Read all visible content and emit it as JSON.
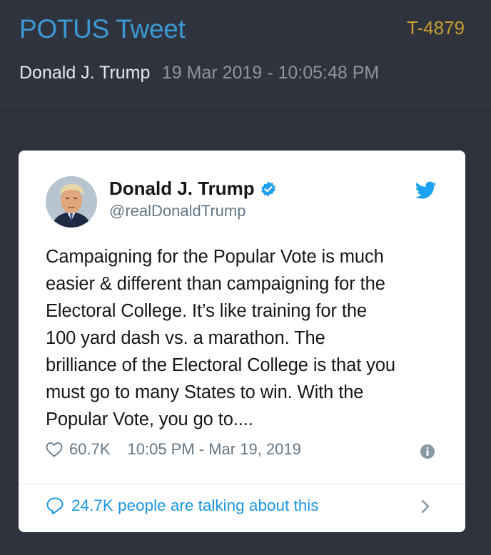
{
  "header": {
    "title": "POTUS Tweet",
    "tweet_id": "T-4879",
    "author": "Donald J. Trump",
    "datetime": "19 Mar 2019 - 10:05:48 PM"
  },
  "tweet": {
    "display_name": "Donald J. Trump",
    "handle": "@realDonaldTrump",
    "text": "Campaigning for the Popular Vote is much\neasier & different than campaigning for the\nElectoral College. It’s like training for the\n100 yard dash vs. a marathon. The\nbrilliance of the Electoral College is that you\nmust go to many States to win. With the\nPopular Vote, you go to....",
    "likes": "60.7K",
    "timestamp": "10:05 PM - Mar 19, 2019",
    "talking": "24.7K people are talking about this"
  },
  "icons": {
    "verified": "verified-badge-icon",
    "bird": "twitter-bird-icon",
    "heart": "heart-icon",
    "info": "info-icon",
    "bubble": "comment-bubble-icon",
    "chevron": "chevron-right-icon"
  },
  "colors": {
    "background": "#2e323c",
    "title_blue": "#3c9ad6",
    "tweet_id_gold": "#c9a02d",
    "twitter_blue": "#1da1f2"
  }
}
